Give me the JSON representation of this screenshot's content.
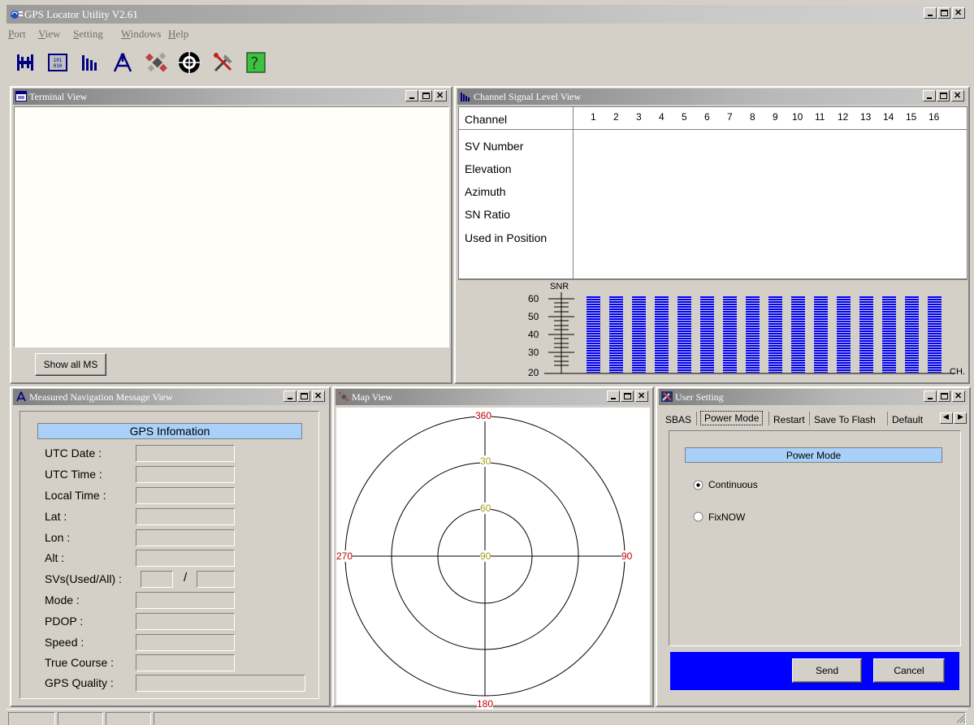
{
  "app": {
    "title": "GPS Locator Utility V2.61"
  },
  "menu": [
    {
      "label": "Port",
      "u": "P"
    },
    {
      "label": "View",
      "u": "V"
    },
    {
      "label": "Setting",
      "u": "S"
    },
    {
      "label": "Windows",
      "u": "W"
    },
    {
      "label": "Help",
      "u": "H"
    }
  ],
  "toolbar": {
    "icons": [
      "connect-icon",
      "terminal-binary-icon",
      "signal-bars-icon",
      "navigation-icon",
      "map-satellite-icon",
      "target-icon",
      "tools-icon",
      "help-icon"
    ],
    "help_glyph": "?"
  },
  "terminal": {
    "title": "Terminal View",
    "show_all_label": "Show all MS"
  },
  "channel": {
    "title": "Channel Signal Level View",
    "header_label": "Channel",
    "channels": [
      "1",
      "2",
      "3",
      "4",
      "5",
      "6",
      "7",
      "8",
      "9",
      "10",
      "11",
      "12",
      "13",
      "14",
      "15",
      "16"
    ],
    "rows": [
      "SV Number",
      "Elevation",
      "Azimuth",
      "SN Ratio",
      "Used in Position"
    ],
    "snr_label": "SNR",
    "ch_label": "CH.",
    "y_ticks": [
      "60",
      "50",
      "40",
      "30",
      "20"
    ],
    "bar_color": "#0000ff"
  },
  "nav": {
    "title": "Measured Navigation Message View",
    "header": "GPS Infomation",
    "fields": [
      "UTC Date :",
      "UTC Time :",
      "Local Time :",
      "Lat :",
      "Lon :",
      "Alt :",
      "SVs(Used/All) :",
      "Mode :",
      "PDOP :",
      "Speed :",
      "True Course :",
      "GPS Quality :"
    ],
    "svs_sep": "/"
  },
  "map": {
    "title": "Map View",
    "ring_labels": {
      "outer": "360",
      "ring30": "30",
      "ring60": "60",
      "center": "90"
    },
    "compass": {
      "north": "360",
      "south": "180",
      "west": "270",
      "east": "90"
    }
  },
  "settings": {
    "title": "User Setting",
    "tabs": [
      "SBAS",
      "Power Mode",
      "Restart",
      "Save To Flash",
      "Default"
    ],
    "selected_tab": "Power Mode",
    "section_title": "Power Mode",
    "options": [
      {
        "label": "Continuous",
        "checked": true
      },
      {
        "label": "FixNOW",
        "checked": false
      }
    ],
    "send_label": "Send",
    "cancel_label": "Cancel",
    "footer_color": "#0000ff"
  }
}
